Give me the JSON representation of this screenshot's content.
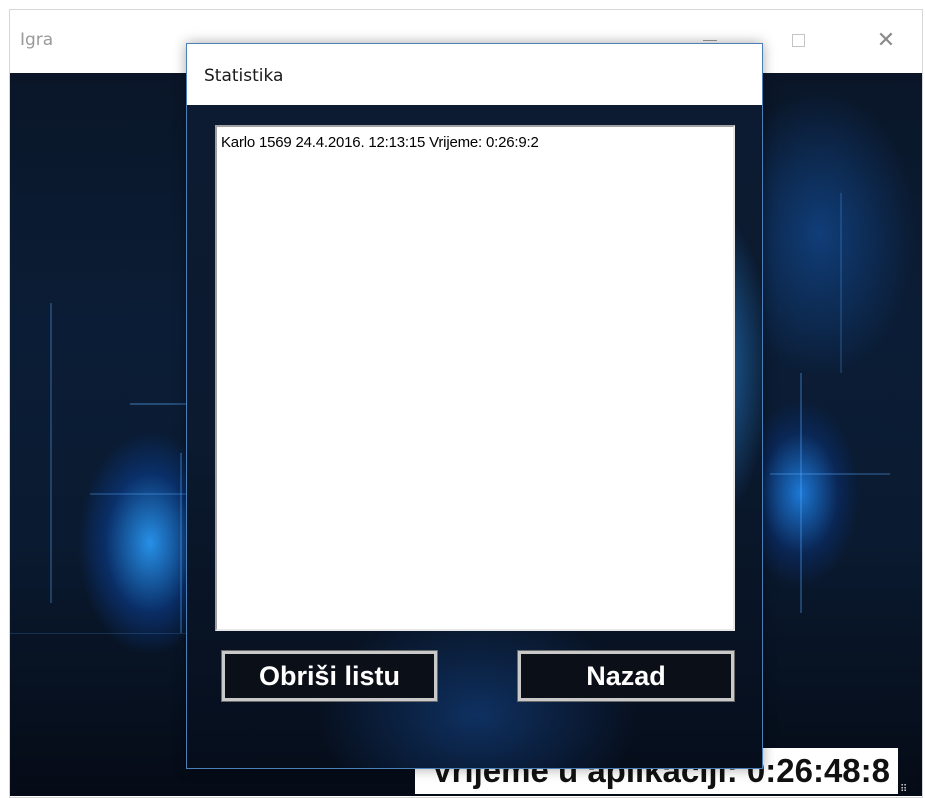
{
  "main_window": {
    "title": "Igra",
    "controls": {
      "minimize_icon": "minimize-icon",
      "maximize_icon": "maximize-icon",
      "close_icon": "close-icon",
      "close_glyph": "✕"
    }
  },
  "status": {
    "time_text": "Vrijeme u aplikaciji: 0:26:48:8"
  },
  "dialog": {
    "title": "Statistika",
    "list": {
      "items": [
        "Karlo 1569 24.4.2016. 12:13:15 Vrijeme: 0:26:9:2"
      ]
    },
    "buttons": {
      "clear_label": "Obriši listu",
      "back_label": "Nazad"
    }
  },
  "colors": {
    "dialog_border": "#4a7fb8",
    "button_background": "#0b0f18",
    "button_border": "#c9c9c9",
    "background_dark": "#0a1628",
    "background_glow": "#2896f0"
  }
}
